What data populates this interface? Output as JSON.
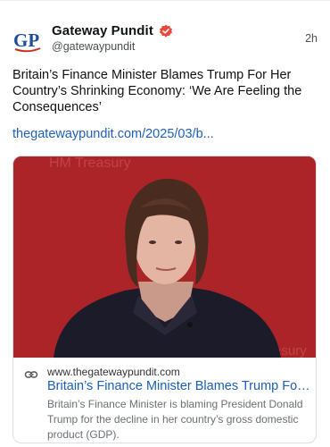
{
  "post": {
    "author_name": "Gateway Pundit",
    "handle": "@gatewaypundit",
    "time": "2h",
    "avatar_text": "GP",
    "text": "Britain’s Finance Minister Blames Trump For Her Country’s Shrinking Economy: ‘We Are Feeling the Consequences’",
    "link_text": "thegatewaypundit.com/2025/03/b..."
  },
  "card": {
    "domain": "www.thegatewaypundit.com",
    "title": "Britain’s Finance Minister Blames Trump For He...",
    "description": "Britain’s Finance Minister is blaming President Donald Trump for the decline in her country’s gross domestic product (GDP).",
    "background_text_top": "HM Treasury",
    "background_text_corner": "asury"
  },
  "colors": {
    "accent_link": "#1d5fb8",
    "verified_badge": "#e8483b",
    "avatar_blue": "#1c4e9a",
    "image_background": "#b5272b"
  },
  "icons": {
    "verified": "verified-badge-icon",
    "link": "link-icon"
  }
}
